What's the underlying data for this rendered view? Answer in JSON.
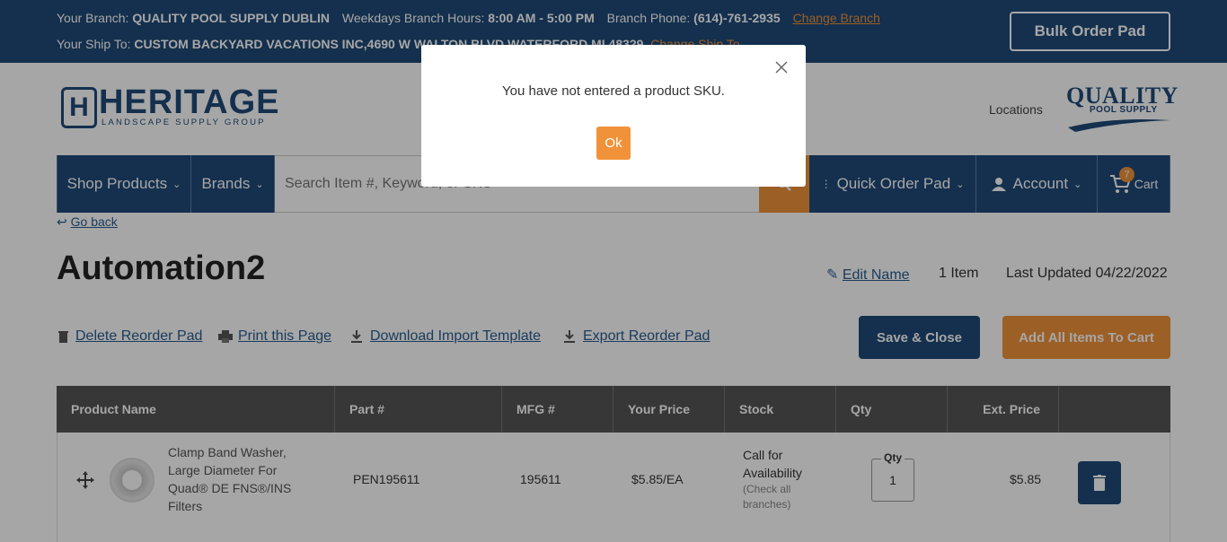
{
  "topbar": {
    "branch_label": "Your Branch:",
    "branch_name": "QUALITY POOL SUPPLY DUBLIN",
    "hours_label": "Weekdays Branch Hours:",
    "hours_value": "8:00 AM - 5:00 PM",
    "phone_label": "Branch Phone:",
    "phone_value": "(614)-761-2935",
    "change_branch": "Change Branch",
    "shipto_label": "Your Ship To:",
    "shipto_value": "CUSTOM BACKYARD VACATIONS INC,4690 W WALTON BLVD WATERFORD MI 48329",
    "change_shipto": "Change Ship To",
    "bulk_order": "Bulk Order Pad"
  },
  "header": {
    "logo_left_word": "HERITAGE",
    "logo_left_sub": "LANDSCAPE SUPPLY GROUP",
    "locations": "Locations",
    "logo_right_line1": "QUALITY",
    "logo_right_line2": "POOL SUPPLY"
  },
  "nav": {
    "shop_products": "Shop Products",
    "brands": "Brands",
    "search_placeholder": "Search Item #, Keyword, or SKU",
    "quick_order": "Quick Order Pad",
    "account": "Account",
    "cart": "Cart",
    "cart_count": "7"
  },
  "main": {
    "go_back": "Go back",
    "title": "Automation2",
    "edit_name": "Edit Name",
    "item_count": "1 Item",
    "last_updated": "Last Updated 04/22/2022",
    "actions": {
      "delete": "Delete Reorder Pad",
      "print": "Print this Page",
      "download": "Download Import Template",
      "export": "Export Reorder Pad"
    },
    "save_close": "Save & Close",
    "add_all": "Add All Items To Cart"
  },
  "table": {
    "headers": [
      "Product Name",
      "Part #",
      "MFG #",
      "Your Price",
      "Stock",
      "Qty",
      "Ext. Price"
    ],
    "rows": [
      {
        "name": "Clamp Band Washer, Large Diameter For Quad® DE FNS®/INS Filters",
        "part": "PEN195611",
        "mfg": "195611",
        "price": "$5.85/EA",
        "stock": "Call for Availability",
        "stock_note": "(Check all branches)",
        "qty_label": "Qty",
        "qty": "1",
        "ext": "$5.85"
      }
    ]
  },
  "modal": {
    "message": "You have not entered a product SKU.",
    "ok": "Ok"
  },
  "colors": {
    "brand_blue": "#1f4a78",
    "accent_orange": "#f0923a"
  }
}
